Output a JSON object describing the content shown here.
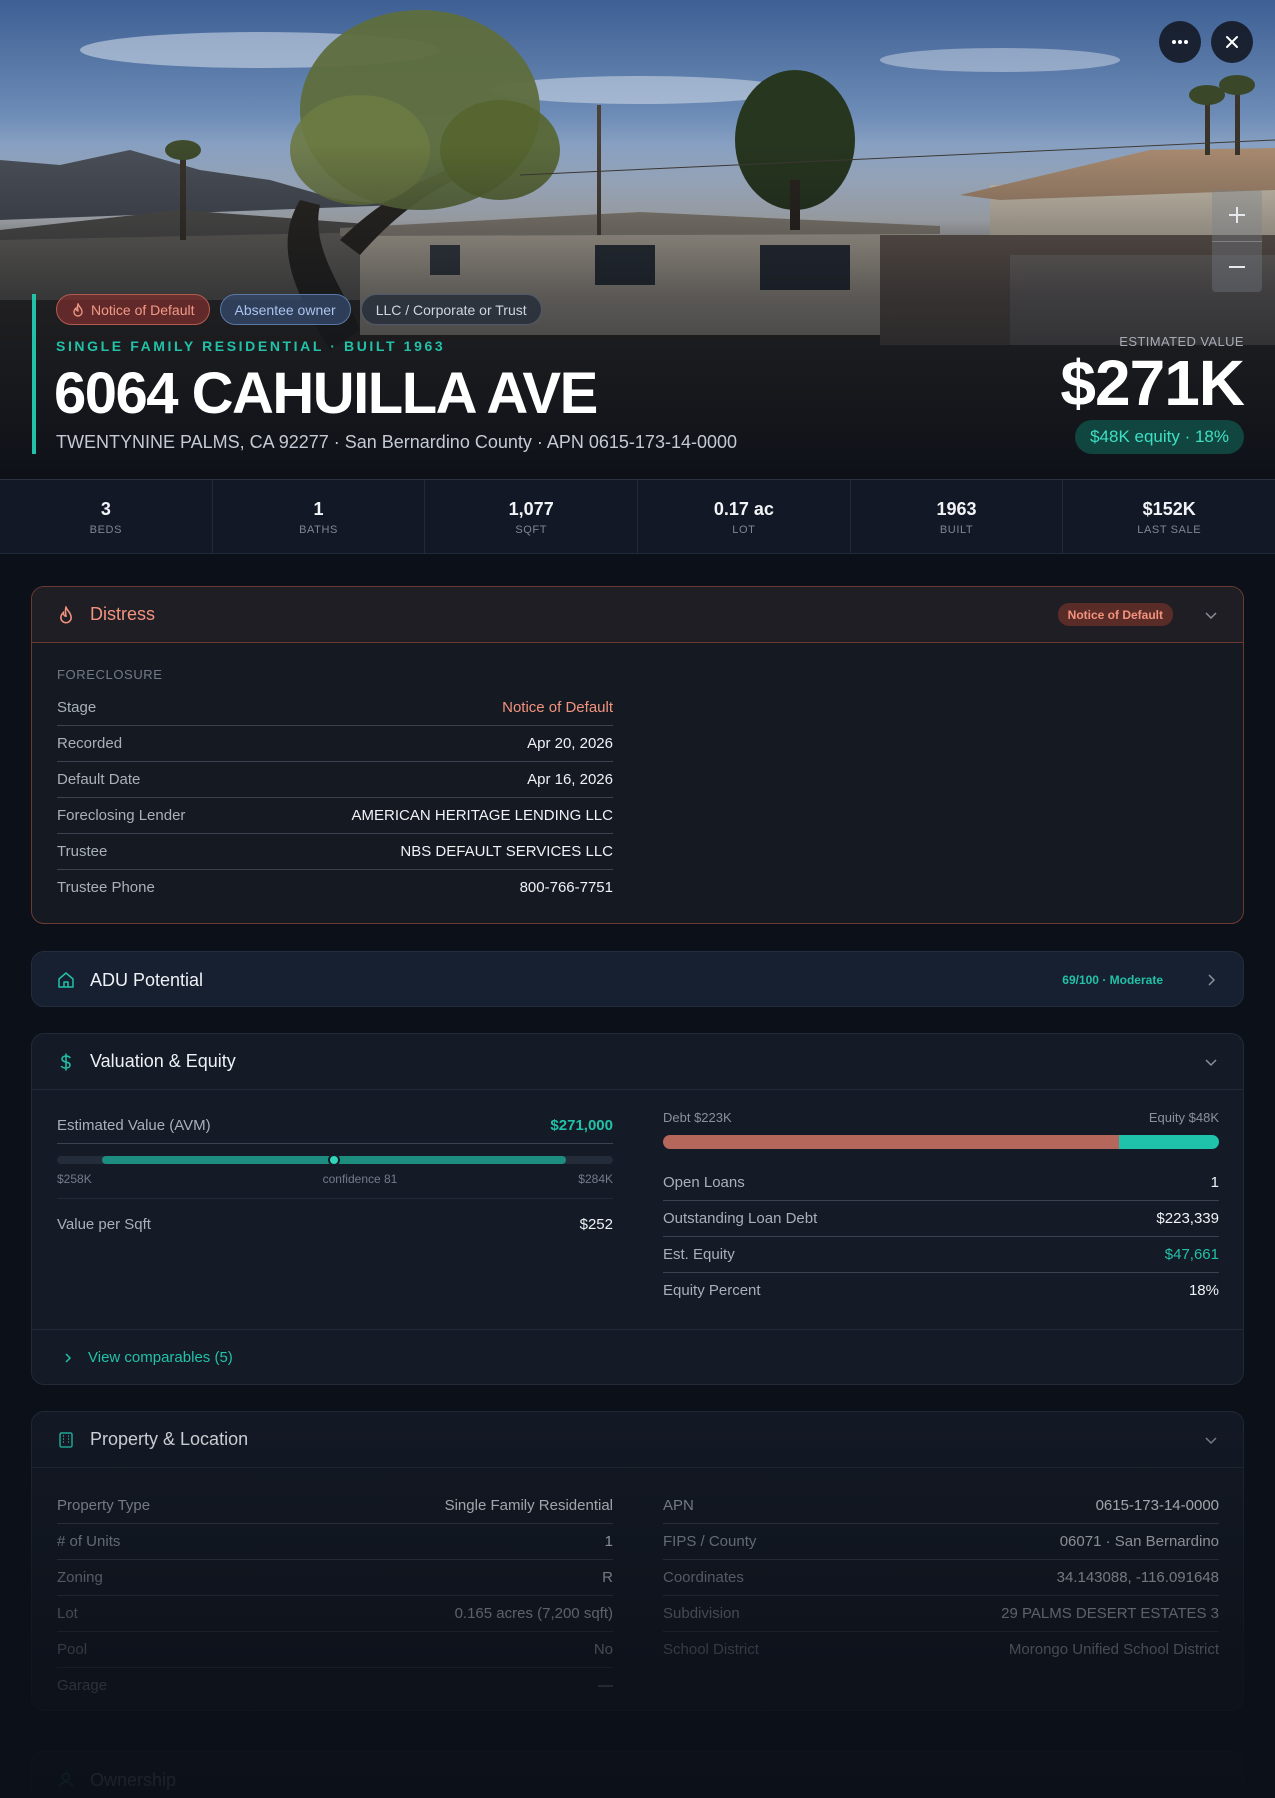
{
  "hero": {
    "chips": [
      {
        "label": "Notice of Default",
        "style": "red",
        "icon": "flame-icon"
      },
      {
        "label": "Absentee owner",
        "style": "blue"
      },
      {
        "label": "LLC / Corporate or Trust",
        "style": "gray"
      }
    ],
    "subtype": "SINGLE FAMILY RESIDENTIAL · BUILT 1963",
    "address": "6064 CAHUILLA AVE",
    "location": "TWENTYNINE PALMS, CA 92277 · San Bernardino County · APN 0615-173-14-0000",
    "est_label": "ESTIMATED VALUE",
    "est_value": "$271K",
    "equity_pill": "$48K equity · 18%",
    "buttons": {
      "more": "more-icon",
      "close": "close-icon",
      "zoom_in": "plus-icon",
      "zoom_out": "minus-icon"
    }
  },
  "stats": [
    {
      "value": "3",
      "label": "BEDS"
    },
    {
      "value": "1",
      "label": "BATHS"
    },
    {
      "value": "1,077",
      "label": "SQFT"
    },
    {
      "value": "0.17 ac",
      "label": "LOT"
    },
    {
      "value": "1963",
      "label": "BUILT"
    },
    {
      "value": "$152K",
      "label": "LAST SALE"
    }
  ],
  "distress": {
    "title": "Distress",
    "icon": "flame-icon",
    "badge": "Notice of Default",
    "section": "FORECLOSURE",
    "rows": [
      {
        "key": "Stage",
        "value": "Notice of Default"
      },
      {
        "key": "Recorded",
        "value": "Apr 20, 2026"
      },
      {
        "key": "Default Date",
        "value": "Apr 16, 2026"
      },
      {
        "key": "Foreclosing Lender",
        "value": "AMERICAN HERITAGE LENDING LLC"
      },
      {
        "key": "Trustee",
        "value": "NBS DEFAULT SERVICES LLC"
      },
      {
        "key": "Trustee Phone",
        "value": "800-766-7751"
      }
    ]
  },
  "adu": {
    "title": "ADU Potential",
    "icon": "home-icon",
    "badge": "69/100 · Moderate"
  },
  "valuation": {
    "title": "Valuation & Equity",
    "icon": "dollar-icon",
    "avm_label": "Estimated Value (AVM)",
    "avm_value": "$271,000",
    "range_low": "$258K",
    "range_high": "$284K",
    "confidence": "confidence 81",
    "value_position": 0.5,
    "per_sqft_label": "Value per Sqft",
    "per_sqft_value": "$252",
    "debt_label": "Debt $223K",
    "equity_label": "Equity $48K",
    "debt_fraction": 0.82,
    "rows": [
      {
        "key": "Open Loans",
        "value": "1"
      },
      {
        "key": "Outstanding Loan Debt",
        "value": "$223,339"
      },
      {
        "key": "Est. Equity",
        "value": "$47,661"
      },
      {
        "key": "Equity Percent",
        "value": "18%"
      }
    ],
    "comparables": "View comparables (5)"
  },
  "property": {
    "title": "Property & Location",
    "icon": "building-icon",
    "left": [
      {
        "key": "Property Type",
        "value": "Single Family Residential"
      },
      {
        "key": "# of Units",
        "value": "1"
      },
      {
        "key": "Zoning",
        "value": "R"
      },
      {
        "key": "Lot",
        "value": "0.165 acres (7,200 sqft)"
      },
      {
        "key": "Pool",
        "value": "No"
      },
      {
        "key": "Garage",
        "value": "—"
      }
    ],
    "right": [
      {
        "key": "APN",
        "value": "0615-173-14-0000"
      },
      {
        "key": "FIPS / County",
        "value": "06071 · San Bernardino"
      },
      {
        "key": "Coordinates",
        "value": "34.143088, -116.091648"
      },
      {
        "key": "Subdivision",
        "value": "29 PALMS DESERT ESTATES 3"
      },
      {
        "key": "School District",
        "value": "Morongo Unified School District"
      }
    ]
  },
  "ownership": {
    "title": "Ownership",
    "icon": "person-icon"
  },
  "colors": {
    "accent": "#22c1a8",
    "danger": "#f3937e",
    "background": "#0c1018",
    "card": "#141a26"
  }
}
